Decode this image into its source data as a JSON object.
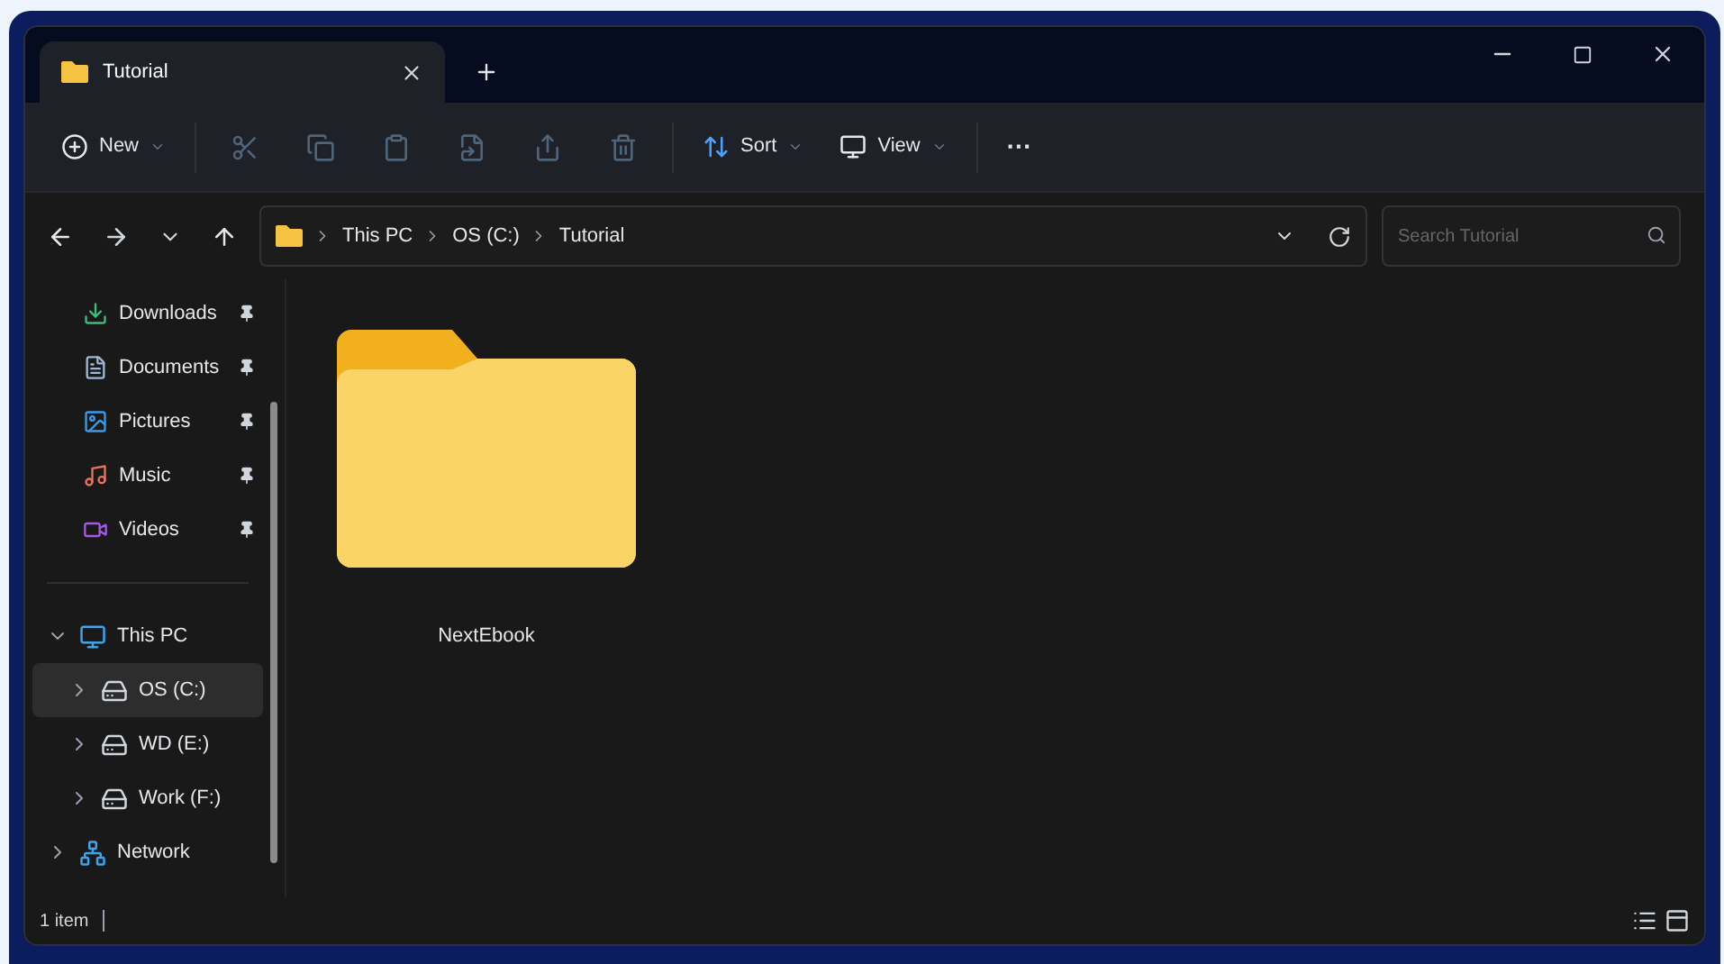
{
  "tab": {
    "title": "Tutorial",
    "selected": true
  },
  "toolbar": [
    {
      "kind": "menu",
      "label": "New",
      "disabled": false
    },
    {
      "kind": "icon",
      "disabled": true
    },
    {
      "kind": "icon",
      "disabled": true
    },
    {
      "kind": "icon",
      "disabled": true
    },
    {
      "kind": "icon",
      "disabled": true
    },
    {
      "kind": "icon",
      "disabled": true
    },
    {
      "kind": "icon",
      "disabled": true
    },
    {
      "kind": "menu",
      "label": "Sort",
      "disabled": false
    },
    {
      "kind": "menu",
      "label": "View",
      "disabled": false
    },
    {
      "kind": "more",
      "label": "···",
      "disabled": false
    }
  ],
  "breadcrumb": [
    "This PC",
    "OS (C:)",
    "Tutorial"
  ],
  "search": {
    "placeholder": "Search Tutorial"
  },
  "quick_access": [
    {
      "label": "Downloads",
      "pinned": true
    },
    {
      "label": "Documents",
      "pinned": true
    },
    {
      "label": "Pictures",
      "pinned": true
    },
    {
      "label": "Music",
      "pinned": true
    },
    {
      "label": "Videos",
      "pinned": true
    }
  ],
  "tree": [
    {
      "label": "This PC",
      "expanded": true,
      "selected": false,
      "children": [
        {
          "label": "OS (C:)",
          "expanded": false,
          "selected": true
        },
        {
          "label": "WD (E:)",
          "expanded": false,
          "selected": false
        },
        {
          "label": "Work (F:)",
          "expanded": false,
          "selected": false
        }
      ]
    },
    {
      "label": "Network",
      "expanded": false,
      "selected": false
    }
  ],
  "files": [
    {
      "name": "NextEbook"
    }
  ],
  "status_bar": {
    "count": "1 item"
  }
}
